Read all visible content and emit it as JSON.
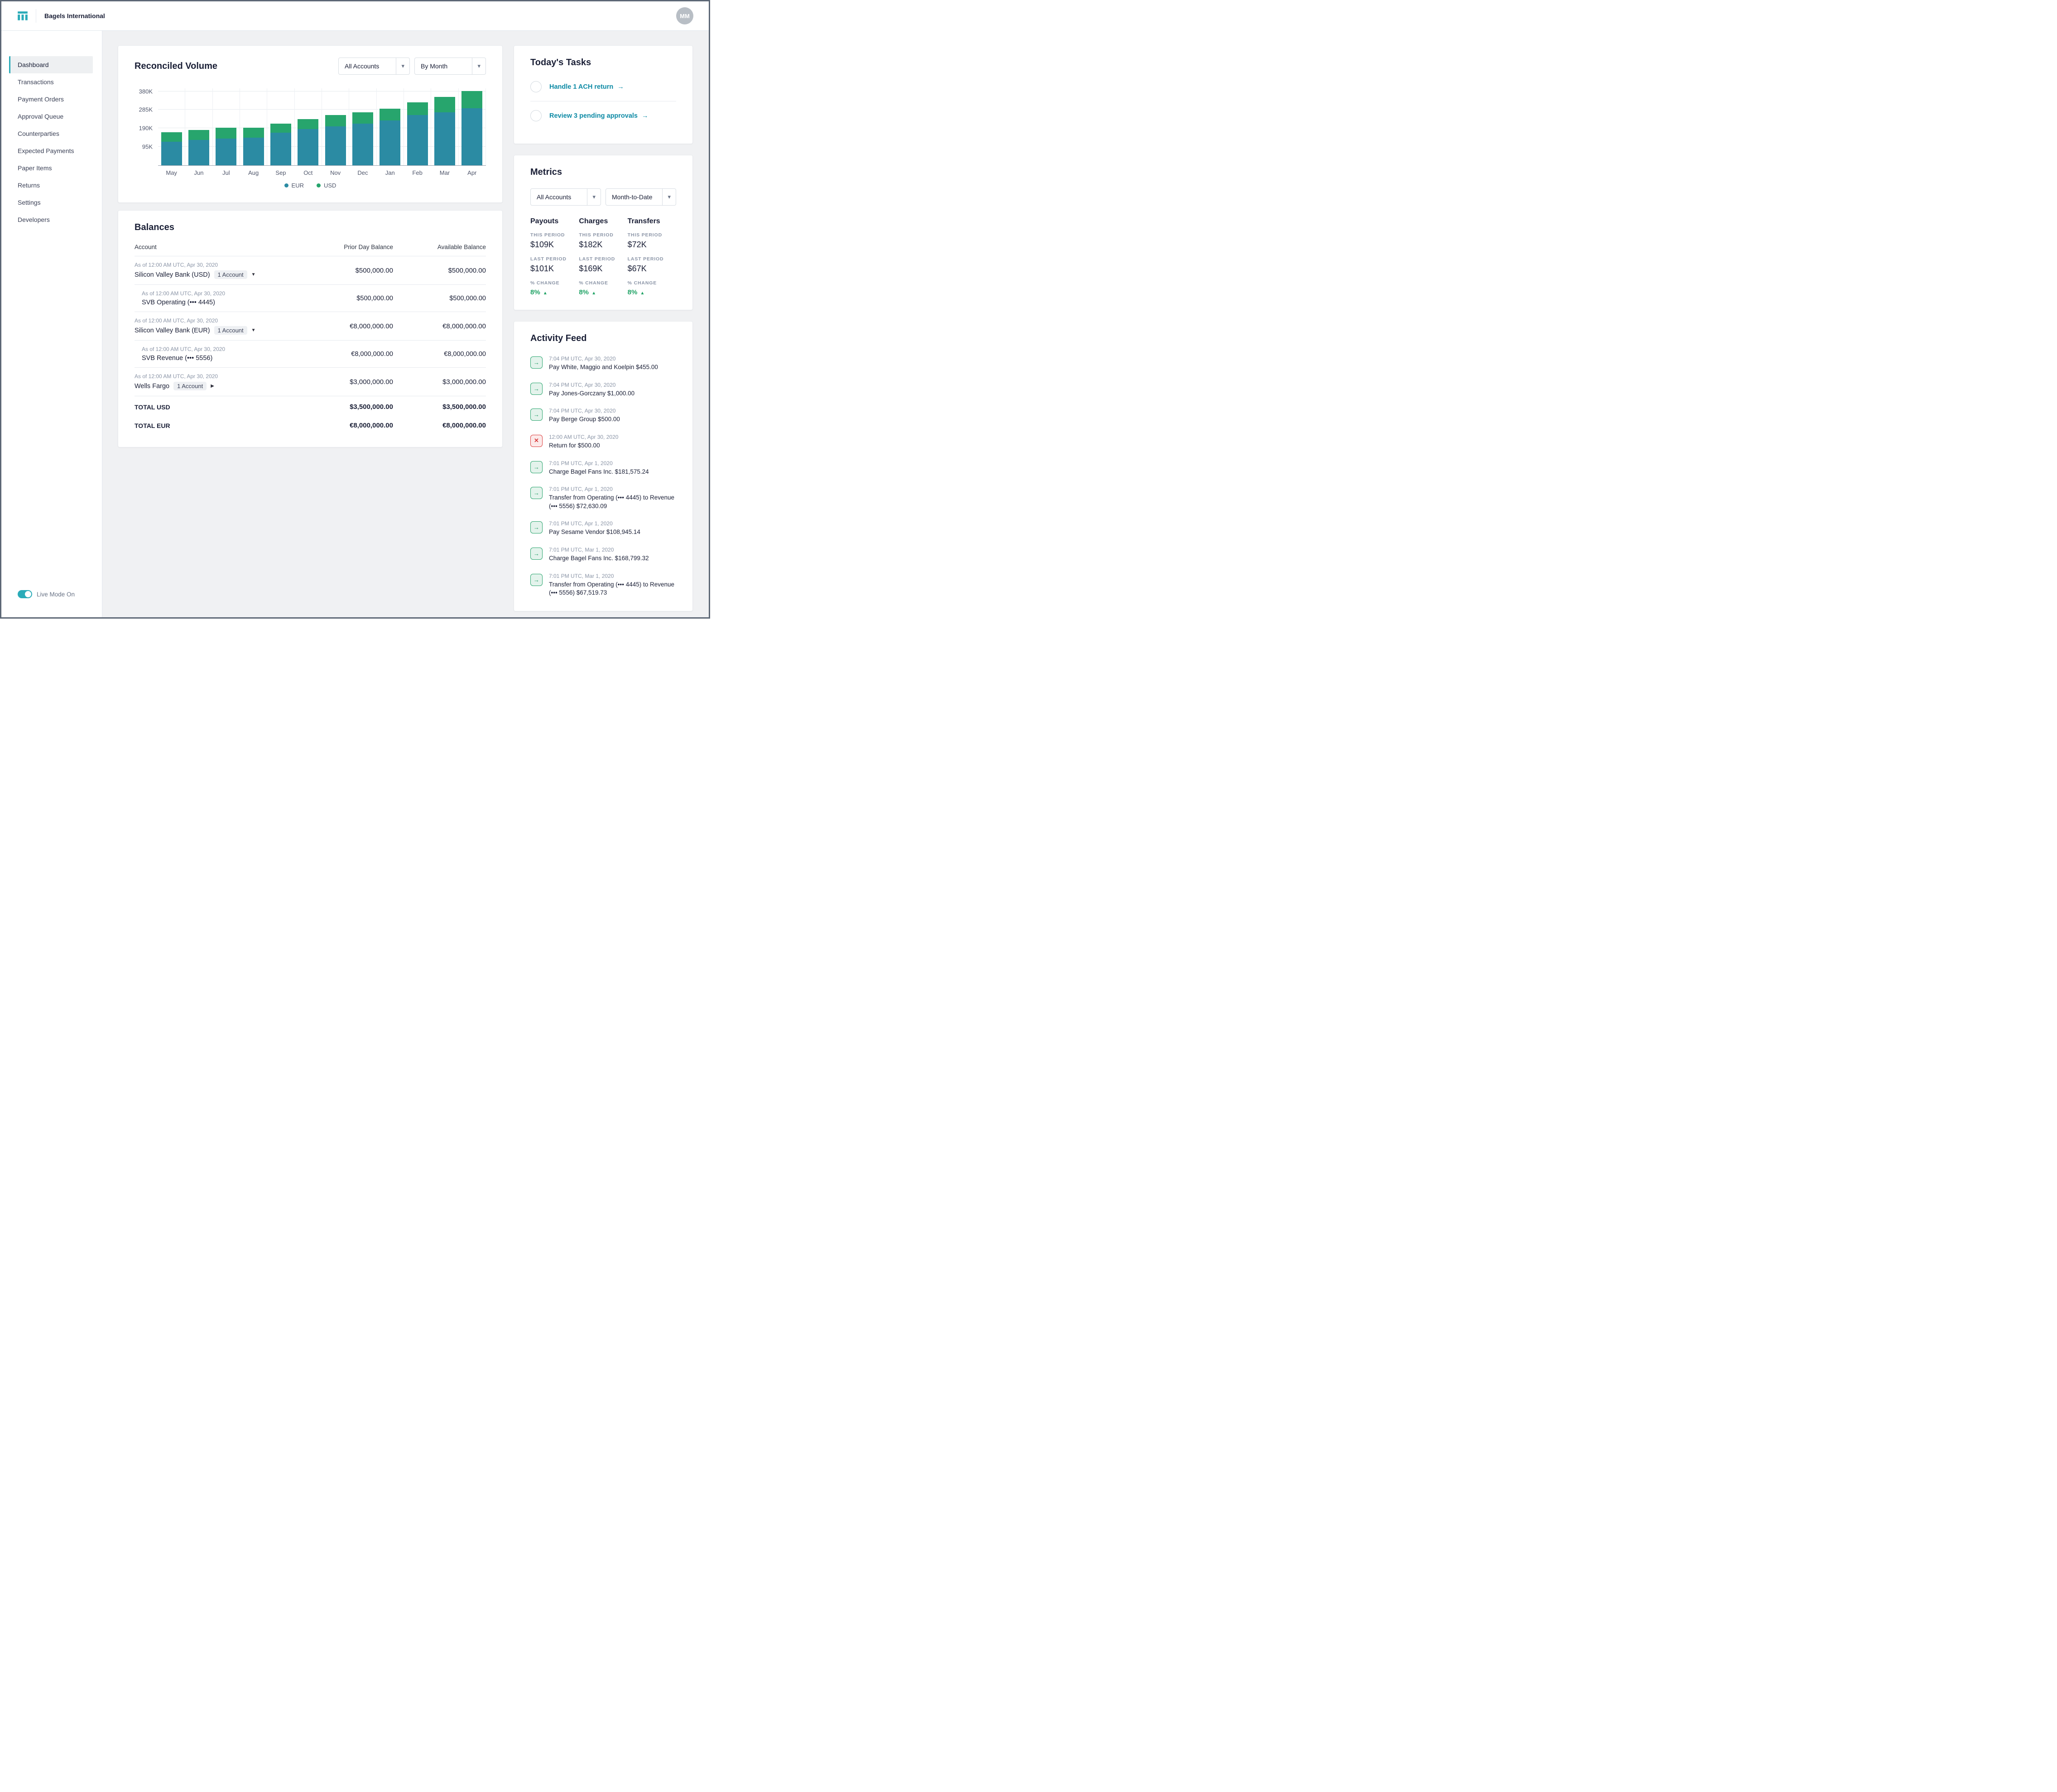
{
  "colors": {
    "accent": "#0d8aa5",
    "accent_bright": "#2aabb8",
    "green": "#21a366",
    "red": "#dd4040"
  },
  "icons": {
    "arrow_right": "→",
    "chevron_down": "▾",
    "triangle_down": "▼",
    "triangle_right": "▶",
    "triangle_up": "▲",
    "close": "✕"
  },
  "header": {
    "company": "Bagels International",
    "avatar_initials": "MM"
  },
  "sidebar": {
    "items": [
      {
        "label": "Dashboard",
        "active": true
      },
      {
        "label": "Transactions",
        "active": false
      },
      {
        "label": "Payment Orders",
        "active": false
      },
      {
        "label": "Approval Queue",
        "active": false
      },
      {
        "label": "Counterparties",
        "active": false
      },
      {
        "label": "Expected Payments",
        "active": false
      },
      {
        "label": "Paper Items",
        "active": false
      },
      {
        "label": "Returns",
        "active": false
      },
      {
        "label": "Settings",
        "active": false
      },
      {
        "label": "Developers",
        "active": false
      }
    ],
    "live_mode_label": "Live Mode On",
    "live_mode_on": true
  },
  "reconciled": {
    "title": "Reconciled Volume",
    "filters": {
      "accounts": "All Accounts",
      "period": "By Month"
    }
  },
  "chart_data": {
    "type": "bar",
    "stacked": true,
    "title": "Reconciled Volume",
    "categories": [
      "May",
      "Jun",
      "Jul",
      "Aug",
      "Sep",
      "Oct",
      "Nov",
      "Dec",
      "Jan",
      "Feb",
      "Mar",
      "Apr"
    ],
    "series": [
      {
        "name": "EUR",
        "color": "#2b8ba3",
        "values": [
          122,
          130,
          137,
          141,
          168,
          186,
          201,
          214,
          231,
          257,
          273,
          293
        ]
      },
      {
        "name": "USD",
        "color": "#27a56d",
        "values": [
          48,
          52,
          55,
          51,
          47,
          51,
          56,
          58,
          60,
          65,
          77,
          88
        ]
      }
    ],
    "unit": "K",
    "tick_suffix": "K",
    "yticks": [
      95,
      190,
      285,
      380
    ],
    "ylim": [
      0,
      395
    ],
    "legend_position": "bottom"
  },
  "balances": {
    "title": "Balances",
    "columns": [
      "Account",
      "Prior Day Balance",
      "Available Balance"
    ],
    "rows": [
      {
        "type": "group",
        "as_of": "As of 12:00 AM UTC, Apr 30, 2020",
        "name": "Silicon Valley Bank (USD)",
        "badge": "1 Account",
        "expanded": true,
        "prior": "$500,000.00",
        "available": "$500,000.00"
      },
      {
        "type": "sub",
        "as_of": "As of 12:00 AM UTC, Apr 30, 2020",
        "name": "SVB Operating (••• 4445)",
        "prior": "$500,000.00",
        "available": "$500,000.00"
      },
      {
        "type": "group",
        "as_of": "As of 12:00 AM UTC, Apr 30, 2020",
        "name": "Silicon Valley Bank (EUR)",
        "badge": "1 Account",
        "expanded": true,
        "prior": "€8,000,000.00",
        "available": "€8,000,000.00"
      },
      {
        "type": "sub",
        "as_of": "As of 12:00 AM UTC, Apr 30, 2020",
        "name": "SVB Revenue (••• 5556)",
        "prior": "€8,000,000.00",
        "available": "€8,000,000.00"
      },
      {
        "type": "group",
        "as_of": "As of 12:00 AM UTC, Apr 30, 2020",
        "name": "Wells Fargo",
        "badge": "1 Account",
        "expanded": false,
        "prior": "$3,000,000.00",
        "available": "$3,000,000.00"
      },
      {
        "type": "total",
        "name": "TOTAL USD",
        "prior": "$3,500,000.00",
        "available": "$3,500,000.00"
      },
      {
        "type": "total",
        "name": "TOTAL EUR",
        "prior": "€8,000,000.00",
        "available": "€8,000,000.00"
      }
    ]
  },
  "tasks": {
    "title": "Today's Tasks",
    "items": [
      "Handle 1 ACH return",
      "Review 3 pending approvals"
    ]
  },
  "metrics": {
    "title": "Metrics",
    "filters": {
      "accounts": "All Accounts",
      "period": "Month-to-Date"
    },
    "row_labels": {
      "this": "THIS PERIOD",
      "last": "LAST PERIOD",
      "change": "% CHANGE"
    },
    "columns": [
      {
        "name": "Payouts",
        "this_period": "$109K",
        "last_period": "$101K",
        "change": "8%"
      },
      {
        "name": "Charges",
        "this_period": "$182K",
        "last_period": "$169K",
        "change": "8%"
      },
      {
        "name": "Transfers",
        "this_period": "$72K",
        "last_period": "$67K",
        "change": "8%"
      }
    ]
  },
  "activity": {
    "title": "Activity Feed",
    "items": [
      {
        "time": "7:04 PM UTC, Apr 30, 2020",
        "text": "Pay White, Maggio and Koelpin $455.00",
        "kind": "payment"
      },
      {
        "time": "7:04 PM UTC, Apr 30, 2020",
        "text": "Pay Jones-Gorczany $1,000.00",
        "kind": "payment"
      },
      {
        "time": "7:04 PM UTC, Apr 30, 2020",
        "text": "Pay Berge Group $500.00",
        "kind": "payment"
      },
      {
        "time": "12:00 AM UTC, Apr 30, 2020",
        "text": "Return for $500.00",
        "kind": "return"
      },
      {
        "time": "7:01 PM UTC, Apr 1, 2020",
        "text": "Charge Bagel Fans Inc. $181,575.24",
        "kind": "payment"
      },
      {
        "time": "7:01 PM UTC, Apr 1, 2020",
        "text": "Transfer from Operating (••• 4445) to Revenue (••• 5556) $72,630.09",
        "kind": "payment"
      },
      {
        "time": "7:01 PM UTC, Apr 1, 2020",
        "text": "Pay Sesame Vendor $108,945.14",
        "kind": "payment"
      },
      {
        "time": "7:01 PM UTC, Mar 1, 2020",
        "text": "Charge Bagel Fans Inc. $168,799.32",
        "kind": "payment"
      },
      {
        "time": "7:01 PM UTC, Mar 1, 2020",
        "text": "Transfer from Operating (••• 4445) to Revenue (••• 5556) $67,519.73",
        "kind": "payment"
      }
    ]
  }
}
